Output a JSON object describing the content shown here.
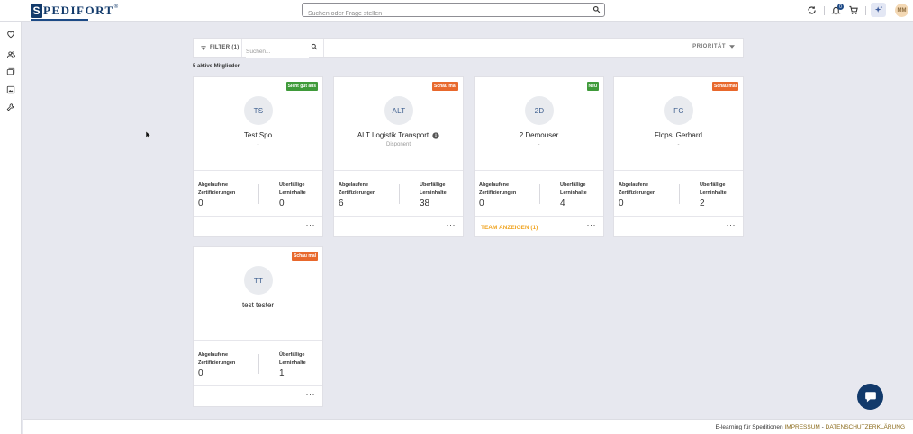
{
  "app": {
    "logo_letter": "S",
    "logo_rest": "PEDIFORT",
    "logo_mark": "®"
  },
  "header": {
    "search_placeholder": "Suchen oder Frage stellen",
    "notification_count": "0",
    "avatar_initials": "MM"
  },
  "filters": {
    "filter_label": "FILTER (1)",
    "search_placeholder": "Suchen...",
    "sort_label": "PRIORITÄT"
  },
  "members": {
    "count_label": "5 aktive Mitglieder"
  },
  "stat_labels": {
    "expired_line1": "Abgelaufene",
    "expired_line2": "Zertifizierungen",
    "overdue_line1": "Überfällige",
    "overdue_line2": "Lerninhalte"
  },
  "cards": [
    {
      "initials": "TS",
      "name": "Test Spo",
      "role": "-",
      "tag": "Sieht gut aus",
      "tag_color": "#3f9a3a",
      "expired": "0",
      "overdue": "0",
      "footer_link": ""
    },
    {
      "initials": "ALT",
      "name": "ALT Logistik Transport",
      "role": "Disponent",
      "tag": "Schau mal",
      "tag_color": "#e8682c",
      "expired": "6",
      "overdue": "38",
      "footer_link": ""
    },
    {
      "initials": "2D",
      "name": "2 Demouser",
      "role": "-",
      "tag": "Neu",
      "tag_color": "#3f9a3a",
      "expired": "0",
      "overdue": "4",
      "footer_link": "TEAM ANZEIGEN (1)"
    },
    {
      "initials": "FG",
      "name": "Flopsi Gerhard",
      "role": "-",
      "tag": "Schau mal",
      "tag_color": "#e8682c",
      "expired": "0",
      "overdue": "2",
      "footer_link": ""
    },
    {
      "initials": "TT",
      "name": "test tester",
      "role": "-",
      "tag": "Schau mal",
      "tag_color": "#e8682c",
      "expired": "0",
      "overdue": "1",
      "footer_link": ""
    }
  ],
  "more_label": "···",
  "footer": {
    "text": "E-learning für Speditionen",
    "impressum": "IMPRESSUM",
    "separator": "-",
    "privacy": "DATENSCHUTZERKLÄRUNG"
  }
}
